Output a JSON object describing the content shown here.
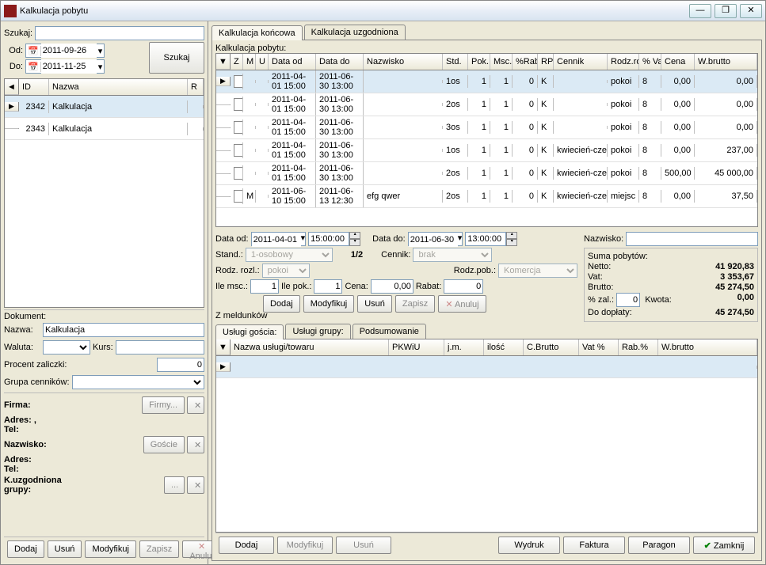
{
  "window": {
    "title": "Kalkulacja pobytu"
  },
  "winbtns": {
    "min": "—",
    "max": "❐",
    "close": "✕"
  },
  "search": {
    "label": "Szukaj:",
    "od_label": "Od:",
    "do_label": "Do:",
    "od_value": "2011-09-26",
    "do_value": "2011-11-25",
    "button": "Szukaj"
  },
  "leftgrid": {
    "headers": {
      "arrow": "◄",
      "id": "ID",
      "nazwa": "Nazwa",
      "r": "R"
    },
    "rows": [
      {
        "id": "2342",
        "nazwa": "Kalkulacja",
        "sel": true
      },
      {
        "id": "2343",
        "nazwa": "Kalkulacja",
        "sel": false
      }
    ]
  },
  "doc": {
    "dokument_label": "Dokument:",
    "nazwa_label": "Nazwa:",
    "nazwa_value": "Kalkulacja",
    "waluta_label": "Waluta:",
    "kurs_label": "Kurs:",
    "procent_label": "Procent zaliczki:",
    "procent_value": "0",
    "grupa_label": "Grupa cenników:",
    "firmy_btn": "Firmy...",
    "firma_label": "Firma:",
    "firma_adres_label": "Adres: ,",
    "firma_tel_label": "Tel:",
    "goscie_btn": "Goście",
    "nazwisko_label": "Nazwisko:",
    "adres_label": "Adres:",
    "tel_label": "Tel:",
    "kuzg_label": "K.uzgodniona",
    "grupy_label": "grupy:",
    "dots_btn": "..."
  },
  "leftbtns": {
    "dodaj": "Dodaj",
    "usun": "Usuń",
    "modyfikuj": "Modyfikuj",
    "zapisz": "Zapisz",
    "anuluj": "Anuluj"
  },
  "maintabs": {
    "koncowa": "Kalkulacja końcowa",
    "uzgodniona": "Kalkulacja uzgodniona"
  },
  "kalk_label": "Kalkulacja pobytu:",
  "maingrid": {
    "headers": {
      "arrow": "▼",
      "z": "Z",
      "m": "M",
      "u": "U",
      "data_od": "Data od",
      "data_do": "Data do",
      "nazwisko": "Nazwisko",
      "std": "Std.",
      "pok": "Pok.",
      "msc": "Msc.",
      "rab": "%Rab",
      "rp": "RP",
      "cennik": "Cennik",
      "rodzro": "Rodz.ro",
      "va": "% Va",
      "cena": "Cena",
      "wbrutto": "W.brutto"
    },
    "rows": [
      {
        "sel": true,
        "m": "",
        "data_od": "2011-04-01 15:00",
        "data_do": "2011-06-30 13:00",
        "nazwisko": "",
        "std": "1os",
        "pok": "1",
        "msc": "1",
        "rab": "0",
        "rp": "K",
        "cennik": "",
        "rodzro": "pokoi",
        "va": "8",
        "cena": "0,00",
        "wbrutto": "0,00"
      },
      {
        "m": "",
        "data_od": "2011-04-01 15:00",
        "data_do": "2011-06-30 13:00",
        "nazwisko": "",
        "std": "2os",
        "pok": "1",
        "msc": "1",
        "rab": "0",
        "rp": "K",
        "cennik": "",
        "rodzro": "pokoi",
        "va": "8",
        "cena": "0,00",
        "wbrutto": "0,00"
      },
      {
        "m": "",
        "data_od": "2011-04-01 15:00",
        "data_do": "2011-06-30 13:00",
        "nazwisko": "",
        "std": "3os",
        "pok": "1",
        "msc": "1",
        "rab": "0",
        "rp": "K",
        "cennik": "",
        "rodzro": "pokoi",
        "va": "8",
        "cena": "0,00",
        "wbrutto": "0,00"
      },
      {
        "m": "",
        "data_od": "2011-04-01 15:00",
        "data_do": "2011-06-30 13:00",
        "nazwisko": "",
        "std": "1os",
        "pok": "1",
        "msc": "1",
        "rab": "0",
        "rp": "K",
        "cennik": "kwiecień-cze",
        "rodzro": "pokoi",
        "va": "8",
        "cena": "0,00",
        "wbrutto": "237,00"
      },
      {
        "m": "",
        "data_od": "2011-04-01 15:00",
        "data_do": "2011-06-30 13:00",
        "nazwisko": "",
        "std": "2os",
        "pok": "1",
        "msc": "1",
        "rab": "0",
        "rp": "K",
        "cennik": "kwiecień-cze",
        "rodzro": "pokoi",
        "va": "8",
        "cena": "500,00",
        "wbrutto": "45 000,00"
      },
      {
        "m": "M",
        "data_od": "2011-06-10 15:00",
        "data_do": "2011-06-13 12:30",
        "nazwisko": "efg qwer",
        "std": "2os",
        "pok": "1",
        "msc": "1",
        "rab": "0",
        "rp": "K",
        "cennik": "kwiecień-cze",
        "rodzro": "miejsc",
        "va": "8",
        "cena": "0,00",
        "wbrutto": "37,50"
      }
    ]
  },
  "detail": {
    "data_od_label": "Data od:",
    "data_od": "2011-04-01",
    "time_od": "15:00:00",
    "data_do_label": "Data do:",
    "data_do": "2011-06-30",
    "time_do": "13:00:00",
    "nazwisko_label": "Nazwisko:",
    "stand_label": "Stand.:",
    "stand": "1-osobowy",
    "pager": "1/2",
    "cennik_label": "Cennik:",
    "cennik": "brak",
    "rodzrozl_label": "Rodz. rozl.:",
    "rodzrozl": "pokoi",
    "rodzpob_label": "Rodz.pob.:",
    "rodzpob": "Komercja",
    "ilemsc_label": "Ile msc.:",
    "ilemsc": "1",
    "ilepok_label": "Ile pok.:",
    "ilepok": "1",
    "cena_label": "Cena:",
    "cena": "0,00",
    "rabat_label": "Rabat:",
    "rabat": "0",
    "zmeld_label": "Z meldunków"
  },
  "detailbtns": {
    "dodaj": "Dodaj",
    "modyfikuj": "Modyfikuj",
    "usun": "Usuń",
    "zapisz": "Zapisz",
    "anuluj": "Anuluj"
  },
  "sum": {
    "title": "Suma pobytów:",
    "netto_label": "Netto:",
    "netto": "41 920,83",
    "vat_label": "Vat:",
    "vat": "3 353,67",
    "brutto_label": "Brutto:",
    "brutto": "45 274,50",
    "zal_label": "% zal.:",
    "zal": "0",
    "kwota_label": "Kwota:",
    "kwota": "0,00",
    "doplaty_label": "Do dopłaty:",
    "doplaty": "45 274,50"
  },
  "svctabs": {
    "goscia": "Usługi gościa:",
    "grupy": "Usługi grupy:",
    "pods": "Podsumowanie"
  },
  "svcgrid": {
    "headers": {
      "arrow": "▼",
      "nazwa": "Nazwa usługi/towaru",
      "pkwiu": "PKWiU",
      "jm": "j.m.",
      "ilosc": "ilość",
      "cbrutto": "C.Brutto",
      "vat": "Vat %",
      "rab": "Rab.%",
      "wbrutto": "W.brutto"
    }
  },
  "svcbtns": {
    "dodaj": "Dodaj",
    "modyfikuj": "Modyfikuj",
    "usun": "Usuń",
    "wydruk": "Wydruk",
    "faktura": "Faktura",
    "paragon": "Paragon",
    "zamknij": "Zamknij"
  }
}
